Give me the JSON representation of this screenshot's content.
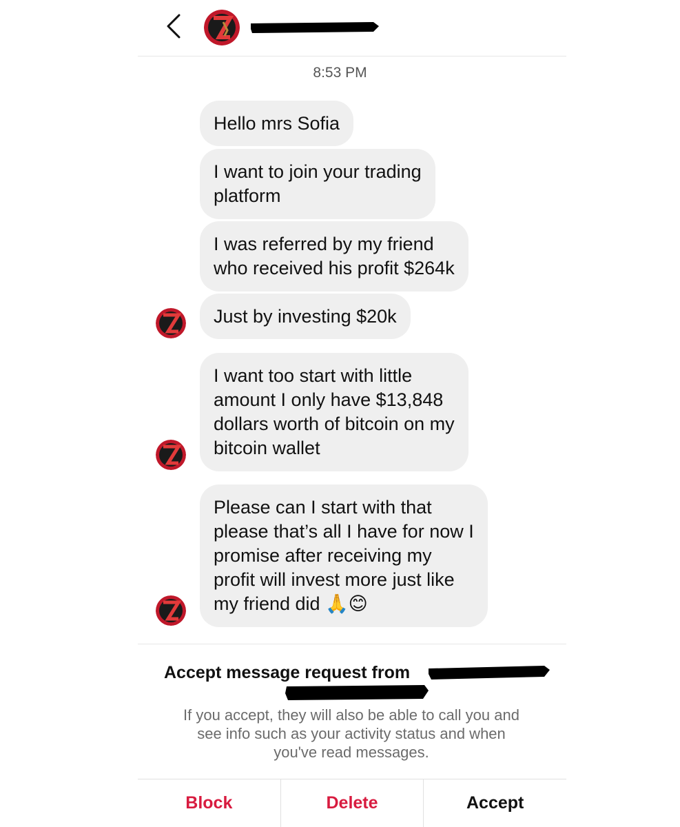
{
  "header": {
    "back_icon": "chevron-left-icon",
    "avatar_icon": "profile-avatar",
    "username_redacted": true
  },
  "conversation": {
    "timestamp": "8:53 PM",
    "messages": [
      {
        "text": "Hello mrs Sofia"
      },
      {
        "text": "I want to join your trading\nplatform"
      },
      {
        "text": "I was referred by my friend\nwho received his profit $264k"
      },
      {
        "text": "Just by investing $20k"
      },
      {
        "text": "I want too start with little\namount I only have $13,848\ndollars worth of bitcoin on my\nbitcoin wallet"
      },
      {
        "text": "Please can I start with that\nplease that’s all I have for now I\npromise after receiving my\nprofit will invest more just like\nmy friend did 🙏😊"
      }
    ]
  },
  "request": {
    "title": "Accept message request from",
    "body": "If you accept, they will also be able to call you and\nsee info such as your activity status and when\nyou've read messages.",
    "actions": {
      "block": "Block",
      "delete": "Delete",
      "accept": "Accept"
    }
  },
  "colors": {
    "bubble": "#efefef",
    "danger": "#d81b3f",
    "muted": "#6b6b6b"
  }
}
